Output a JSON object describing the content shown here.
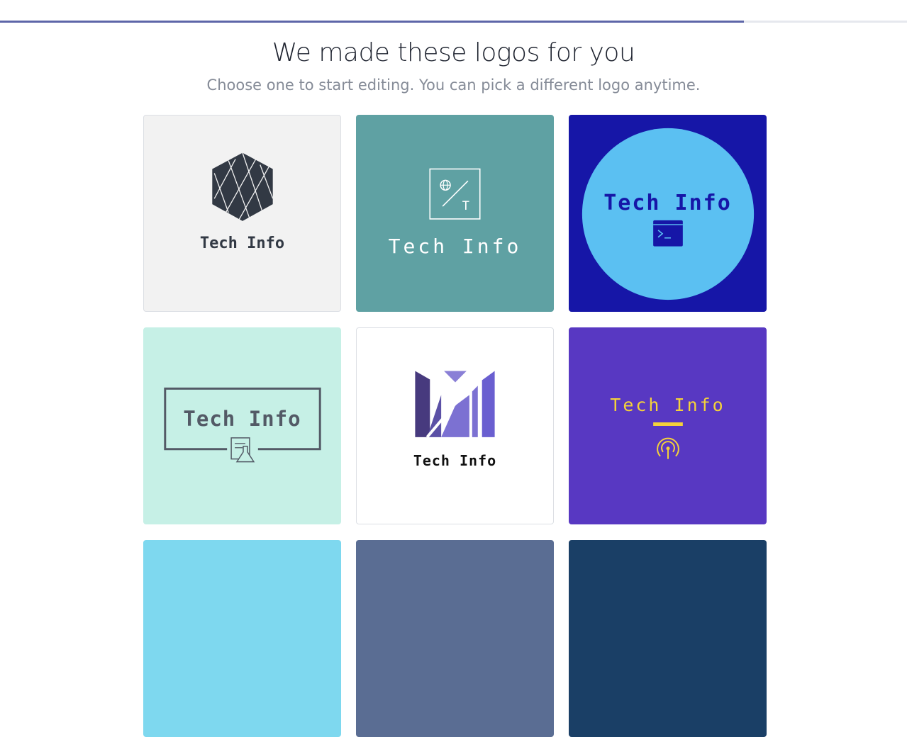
{
  "header": {
    "logo_icon": "brand-mark-icon",
    "progress_percent": 82
  },
  "main": {
    "title": "We made these logos for you",
    "subtitle": "Choose one to start editing. You can pick a different logo anytime."
  },
  "logos": [
    {
      "text": "Tech Info",
      "icon": "geometric-hexagon-icon",
      "bg": "#f2f2f2",
      "fg": "#323944"
    },
    {
      "text": "Tech Info",
      "icon": "globe-slash-t-icon",
      "bg": "#5fa1a3",
      "fg": "#ffffff"
    },
    {
      "text": "Tech Info",
      "icon": "terminal-icon",
      "bg": "#1616a7",
      "fg": "#1616a7",
      "accent": "#5bc0f2"
    },
    {
      "text": "Tech Info",
      "icon": "lab-document-icon",
      "bg": "#c6f0e6",
      "fg": "#535a66"
    },
    {
      "text": "Tech Info",
      "icon": "bar-chart-m-icon",
      "bg": "#ffffff",
      "fg": "#111111",
      "accent": "#6b5fd0"
    },
    {
      "text": "Tech Info",
      "icon": "broadcast-icon",
      "bg": "#5838c2",
      "fg": "#f4d23a"
    },
    {
      "text": "",
      "icon": "",
      "bg": "#7ed8ef"
    },
    {
      "text": "",
      "icon": "",
      "bg": "#5a6d93"
    },
    {
      "text": "",
      "icon": "",
      "bg": "#1a3f66"
    }
  ]
}
